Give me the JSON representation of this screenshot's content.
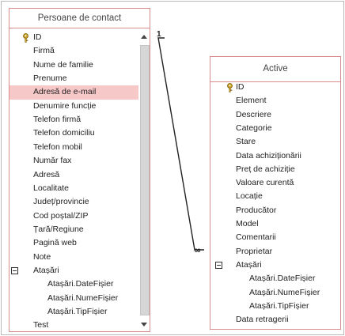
{
  "tables": {
    "persoane": {
      "title": "Persoane de contact",
      "fields": [
        {
          "label": "ID",
          "key": true
        },
        {
          "label": "Firmă"
        },
        {
          "label": "Nume de familie"
        },
        {
          "label": "Prenume"
        },
        {
          "label": "Adresă de e-mail",
          "selected": true
        },
        {
          "label": "Denumire funcție"
        },
        {
          "label": "Telefon firmă"
        },
        {
          "label": "Telefon domiciliu"
        },
        {
          "label": "Telefon mobil"
        },
        {
          "label": "Număr fax"
        },
        {
          "label": "Adresă"
        },
        {
          "label": "Localitate"
        },
        {
          "label": "Județ/provincie"
        },
        {
          "label": "Cod poștal/ZIP"
        },
        {
          "label": "Țară/Regiune"
        },
        {
          "label": "Pagină web"
        },
        {
          "label": "Note"
        },
        {
          "label": "Atașări",
          "collapsible": true
        },
        {
          "label": "Atașări.DateFișier",
          "sub": true
        },
        {
          "label": "Atașări.NumeFișier",
          "sub": true
        },
        {
          "label": "Atașări.TipFișier",
          "sub": true
        },
        {
          "label": "Test"
        }
      ]
    },
    "active": {
      "title": "Active",
      "fields": [
        {
          "label": "ID",
          "key": true
        },
        {
          "label": "Element"
        },
        {
          "label": "Descriere"
        },
        {
          "label": "Categorie"
        },
        {
          "label": "Stare"
        },
        {
          "label": "Data achiziționării"
        },
        {
          "label": "Preț de achiziție"
        },
        {
          "label": "Valoare curentă"
        },
        {
          "label": "Locație"
        },
        {
          "label": "Producător"
        },
        {
          "label": "Model"
        },
        {
          "label": "Comentarii"
        },
        {
          "label": "Proprietar"
        },
        {
          "label": "Atașări",
          "collapsible": true
        },
        {
          "label": "Atașări.DateFișier",
          "sub": true
        },
        {
          "label": "Atașări.NumeFișier",
          "sub": true
        },
        {
          "label": "Atașări.TipFișier",
          "sub": true
        },
        {
          "label": "Data retragerii"
        }
      ]
    }
  },
  "relationship": {
    "one_symbol": "1",
    "many_symbol": "∞"
  },
  "colors": {
    "table_border": "#d98c8c",
    "selected_row": "#f7c8c8",
    "key_gold": "#c9a227"
  }
}
